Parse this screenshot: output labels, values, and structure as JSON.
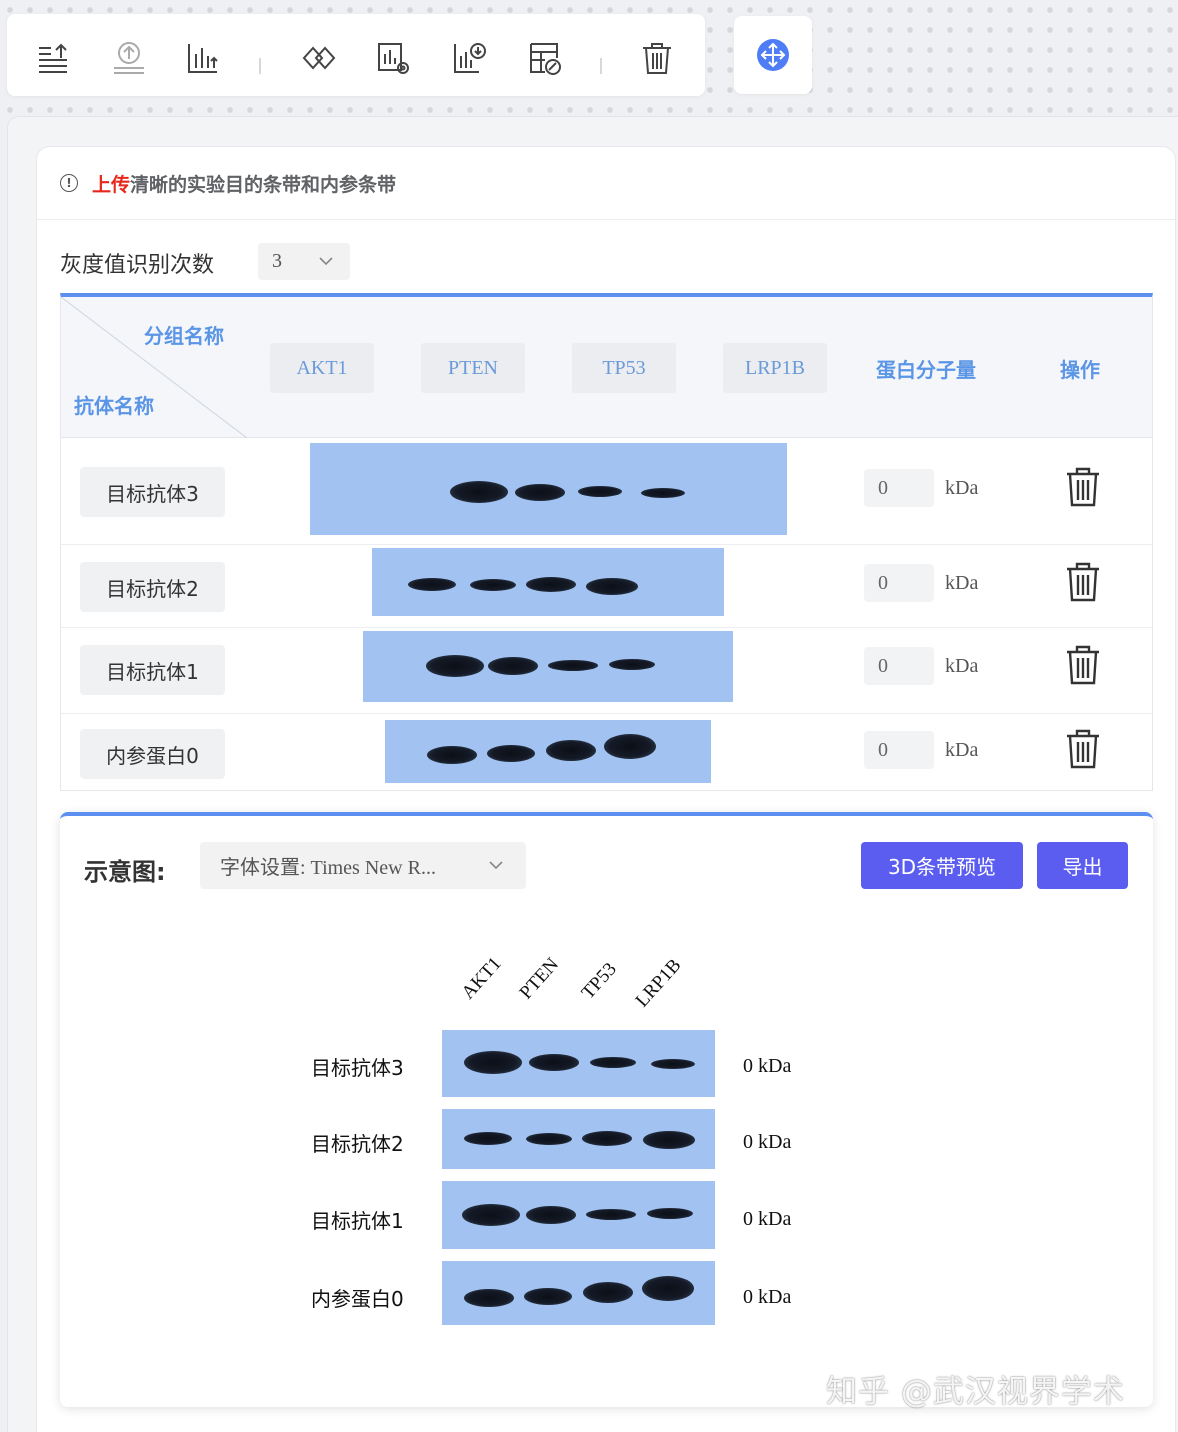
{
  "toolbar": {
    "tools": [
      {
        "icon": "upload-lines-icon"
      },
      {
        "icon": "upload-circle-icon"
      },
      {
        "icon": "bar-chart-upload-icon"
      },
      {
        "icon": "diamond-link-icon"
      },
      {
        "icon": "chart-settings-icon"
      },
      {
        "icon": "chart-download-icon"
      },
      {
        "icon": "table-edit-icon"
      },
      {
        "icon": "trash-icon"
      }
    ],
    "move_icon": "move-arrows-icon"
  },
  "notice": {
    "icon": "info-icon",
    "highlight": "上传",
    "text": "清晰的实验目的条带和内参条带"
  },
  "gray_detect": {
    "label": "灰度值识别次数",
    "value": "3"
  },
  "table": {
    "header_group": "分组名称",
    "header_antibody": "抗体名称",
    "groups": [
      "AKT1",
      "PTEN",
      "TP53",
      "LRP1B"
    ],
    "header_mw": "蛋白分子量",
    "header_op": "操作",
    "rows": [
      {
        "antibody": "目标抗体3",
        "mw": "0",
        "unit": "kDa"
      },
      {
        "antibody": "目标抗体2",
        "mw": "0",
        "unit": "kDa"
      },
      {
        "antibody": "目标抗体1",
        "mw": "0",
        "unit": "kDa"
      },
      {
        "antibody": "内参蛋白0",
        "mw": "0",
        "unit": "kDa"
      }
    ]
  },
  "schematic": {
    "title": "示意图:",
    "font_setting": "字体设置: Times New R...",
    "btn_3d": "3D条带预览",
    "btn_export": "导出",
    "columns": [
      "AKT1",
      "PTEN",
      "TP53",
      "LRP1B"
    ],
    "rows": [
      {
        "antibody": "目标抗体3",
        "mw": "0 kDa"
      },
      {
        "antibody": "目标抗体2",
        "mw": "0 kDa"
      },
      {
        "antibody": "目标抗体1",
        "mw": "0 kDa"
      },
      {
        "antibody": "内参蛋白0",
        "mw": "0 kDa"
      }
    ]
  },
  "watermark": "知乎 @武汉视界学术",
  "colors": {
    "accent_blue": "#5b8ff0",
    "button_purple": "#5b5cf0",
    "blot_blue": "#a2c3f2",
    "notice_red": "#e8271c",
    "header_text": "#5a95e6"
  }
}
